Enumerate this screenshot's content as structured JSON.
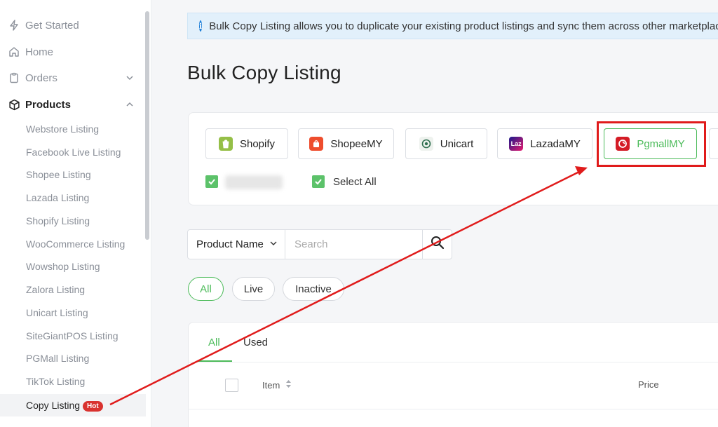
{
  "sidebar": {
    "nav": [
      {
        "label": "Get Started",
        "icon": "bolt-icon"
      },
      {
        "label": "Home",
        "icon": "home-icon"
      },
      {
        "label": "Orders",
        "icon": "clipboard-icon"
      },
      {
        "label": "Products",
        "icon": "box-icon"
      }
    ],
    "products_sub": [
      "Webstore Listing",
      "Facebook Live Listing",
      "Shopee Listing",
      "Lazada Listing",
      "Shopify Listing",
      "WooCommerce Listing",
      "Wowshop Listing",
      "Zalora Listing",
      "Unicart Listing",
      "SiteGiantPOS Listing",
      "PGMall Listing",
      "TikTok Listing",
      "Copy Listing"
    ],
    "hot_badge": "Hot"
  },
  "banner": {
    "text": "Bulk Copy Listing allows you to duplicate your existing product listings and sync them across other marketplaces."
  },
  "page_title": "Bulk Copy Listing",
  "marketplaces": [
    {
      "label": "Shopify",
      "color": "#95bf47"
    },
    {
      "label": "ShopeeMY",
      "color": "#ee4d2d"
    },
    {
      "label": "Unicart",
      "color": "#2f6f4f"
    },
    {
      "label": "LazadaMY",
      "color": "#1a1a8c"
    },
    {
      "label": "PgmallMY",
      "color": "#d41c26",
      "selected": true
    }
  ],
  "select_all": "Select All",
  "search": {
    "field_label": "Product Name",
    "placeholder": "Search"
  },
  "status_filters": [
    "All",
    "Live",
    "Inactive"
  ],
  "tabs": [
    "All",
    "Used"
  ],
  "table": {
    "headers": [
      "Item",
      "Price"
    ]
  },
  "colors": {
    "accent": "#4cbb5a",
    "highlight": "#e01b1b",
    "hot": "#d9322f",
    "info": "#1e7fd8"
  }
}
